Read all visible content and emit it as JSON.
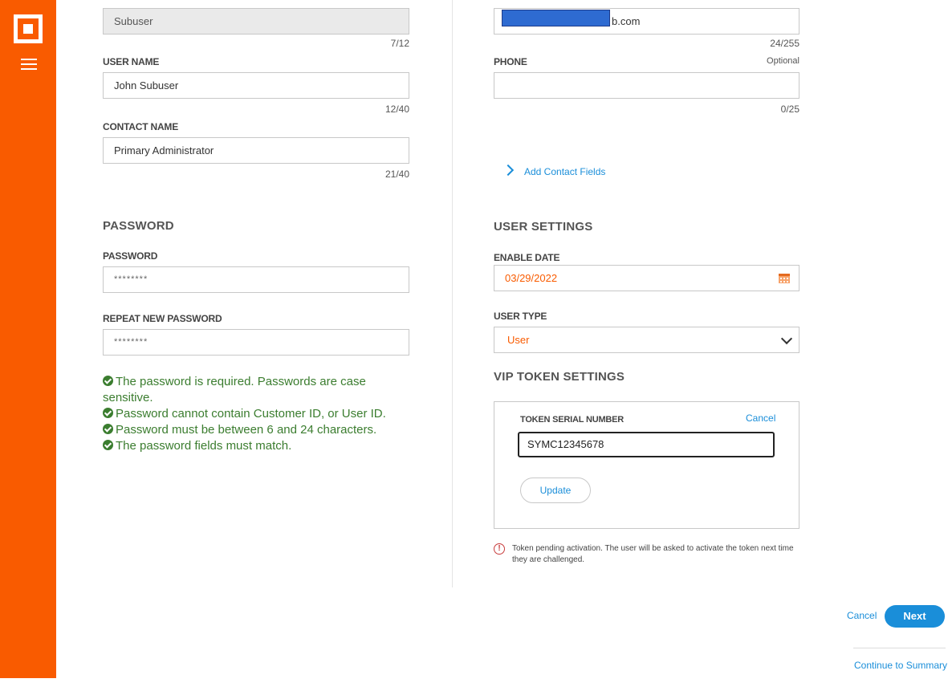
{
  "left": {
    "subuser_field": {
      "value": "Subuser",
      "counter": "7/12"
    },
    "user_name": {
      "label": "USER NAME",
      "value": "John Subuser",
      "counter": "12/40"
    },
    "contact_name": {
      "label": "CONTACT NAME",
      "value": "Primary Administrator",
      "counter": "21/40"
    },
    "password_section": {
      "title": "PASSWORD",
      "password_label": "PASSWORD",
      "password_value": "********",
      "repeat_label": "REPEAT NEW PASSWORD",
      "repeat_value": "********",
      "rules": [
        "The password is required. Passwords are case",
        "sensitive.",
        "Password cannot contain Customer ID, or User ID.",
        "Password must be between 6 and 24 characters.",
        "The password fields must match."
      ]
    }
  },
  "right": {
    "email_field": {
      "value_suffix": "b.com",
      "counter": "24/255"
    },
    "phone": {
      "label": "PHONE",
      "optional": "Optional",
      "value": "",
      "counter": "0/25"
    },
    "add_contact_fields": "Add Contact Fields",
    "user_settings": {
      "title": "USER SETTINGS",
      "enable_date_label": "ENABLE DATE",
      "enable_date_value": "03/29/2022",
      "user_type_label": "USER TYPE",
      "user_type_value": "User"
    },
    "vip": {
      "title": "VIP TOKEN SETTINGS",
      "serial_label": "TOKEN SERIAL NUMBER",
      "cancel": "Cancel",
      "serial_value": "SYMC12345678",
      "update": "Update",
      "warning": "Token pending activation. The user will be asked to activate the token next time they are challenged."
    }
  },
  "footer": {
    "cancel": "Cancel",
    "next": "Next",
    "continue": "Continue to Summary"
  },
  "colors": {
    "brand": "#f95b00",
    "link": "#1a8ed9",
    "success": "#3b7d2f",
    "warning": "#c83c3c"
  }
}
